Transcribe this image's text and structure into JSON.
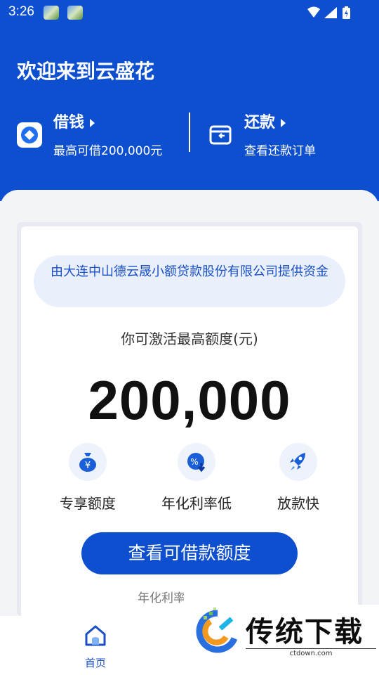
{
  "status_bar": {
    "time": "3:26"
  },
  "header": {
    "welcome": "欢迎来到云盛花",
    "borrow": {
      "title": "借钱",
      "subtitle": "最高可借200,000元"
    },
    "repay": {
      "title": "还款",
      "subtitle": "查看还款订单"
    }
  },
  "card": {
    "funder_text": "由大连中山德云晟小额贷款股份有限公司提供资金",
    "limit_label": "你可激活最高额度(元)",
    "limit_amount": "200,000",
    "features": [
      {
        "label": "专享额度",
        "icon": "money-bag-icon"
      },
      {
        "label": "年化利率低",
        "icon": "percent-down-icon"
      },
      {
        "label": "放款快",
        "icon": "rocket-icon"
      }
    ],
    "cta_label": "查看可借款额度",
    "rate_note": "年化利率"
  },
  "bottom_nav": {
    "home_label": "首页"
  },
  "watermark": {
    "text": "传统下载",
    "url": "ctdown.com"
  },
  "colors": {
    "primary": "#0d4fcf",
    "background": "#f2f4f7",
    "funder_bg": "#e9f0fb"
  }
}
